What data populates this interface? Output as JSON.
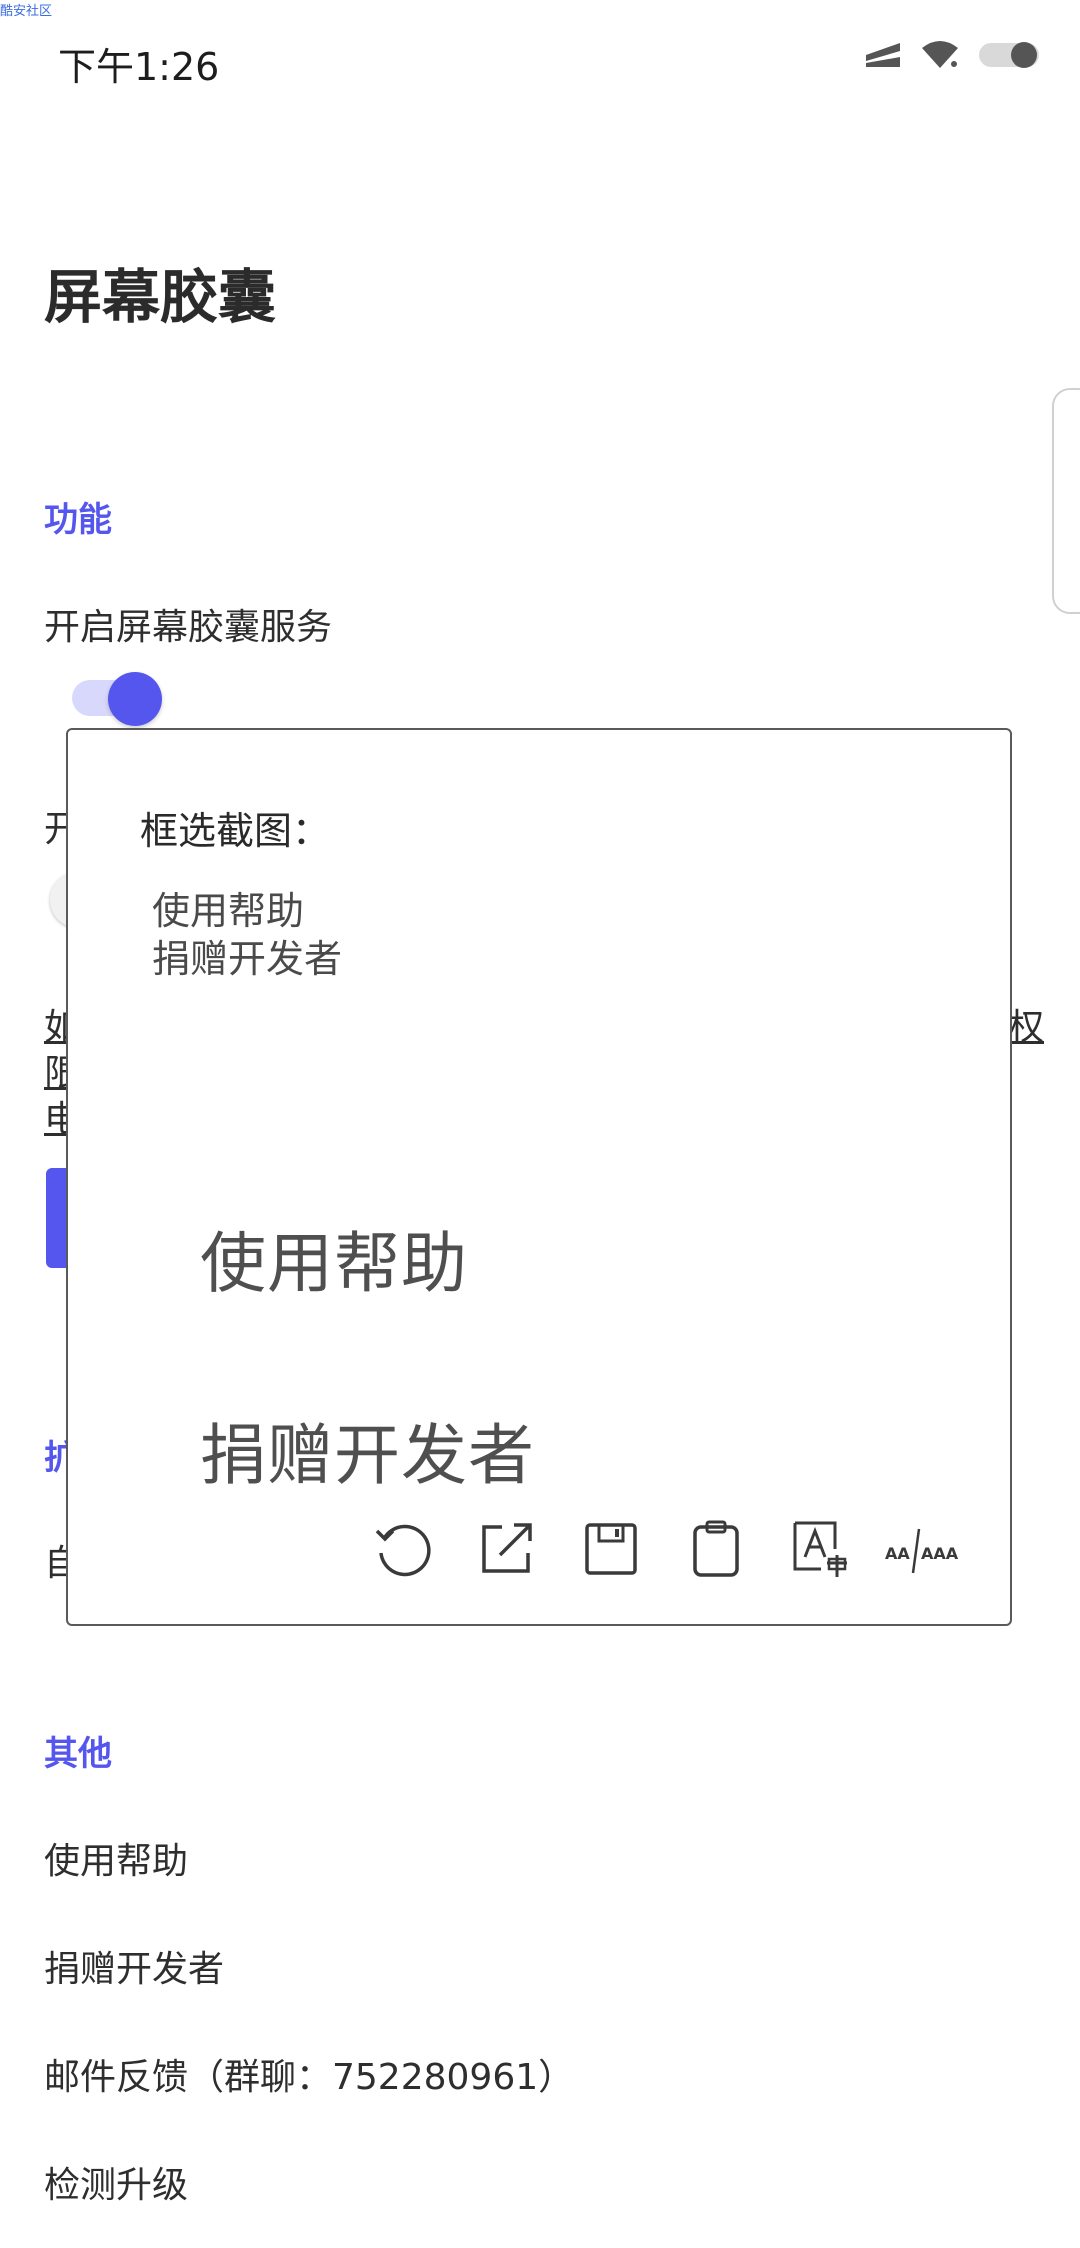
{
  "status_bar": {
    "watermark": "酷安社区",
    "time": "下午1:26"
  },
  "page": {
    "title": "屏幕胶囊",
    "sections": {
      "features": "功能",
      "extension_partial": "扩",
      "others": "其他"
    },
    "prefs": {
      "enable_service": "开启屏幕胶囊服务",
      "second_pref_partial": "开",
      "third_partial": "自"
    },
    "link_partial": {
      "line1_left": "如",
      "line1_right": "权",
      "line2_left": "限",
      "line3_left": "电"
    },
    "other_items": [
      "使用帮助",
      "捐赠开发者",
      "邮件反馈（群聊：752280961）",
      "检测升级"
    ],
    "toggles": {
      "enable_service_on": true,
      "second_on": false
    }
  },
  "dialog": {
    "title": "框选截图：",
    "ocr_lines": [
      "使用帮助",
      "捐赠开发者"
    ],
    "preview_lines": [
      "使用帮助",
      "捐赠开发者"
    ],
    "toolbar_icons": [
      "refresh-icon",
      "share-icon",
      "save-icon",
      "clipboard-icon",
      "translate-icon",
      "font-size-icon"
    ],
    "font_size_label": "AA/AAA"
  },
  "colors": {
    "accent": "#5556ee",
    "accent_light": "#d7d8fb",
    "text": "#2e2e2e"
  }
}
